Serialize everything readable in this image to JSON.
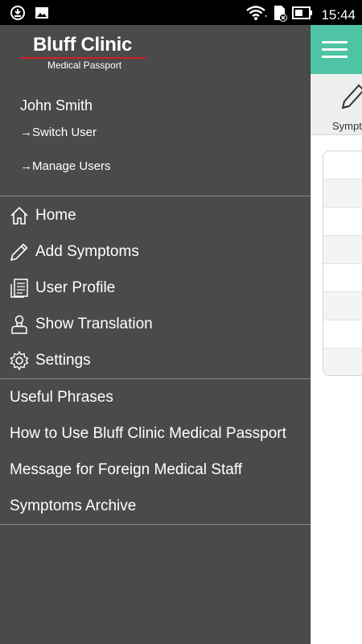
{
  "status_bar": {
    "time": "15:44",
    "icons": [
      "sync-icon",
      "image-icon",
      "wifi-icon",
      "sim-icon",
      "battery-icon"
    ]
  },
  "drawer": {
    "logo": {
      "title": "Bluff Clinic",
      "subtitle": "Medical Passport",
      "accent_color": "#d21f25"
    },
    "user": {
      "name": "John Smith",
      "switch_user": "→Switch User",
      "manage_users": "→Manage Users"
    },
    "nav_items": [
      {
        "label": "Home",
        "icon": "home-icon"
      },
      {
        "label": "Add Symptoms",
        "icon": "pencil-icon"
      },
      {
        "label": "User Profile",
        "icon": "profile-icon"
      },
      {
        "label": "Show Translation",
        "icon": "person-icon"
      },
      {
        "label": "Settings",
        "icon": "gear-icon"
      }
    ],
    "secondary_items": [
      {
        "label": "Useful Phrases"
      },
      {
        "label": "How to Use Bluff Clinic Medical Passport"
      },
      {
        "label": "Message for Foreign Medical Staff"
      },
      {
        "label": "Symptoms Archive"
      }
    ]
  },
  "background_app": {
    "header_color": "#4fc3a5",
    "toolbar_label": "Sympto"
  }
}
